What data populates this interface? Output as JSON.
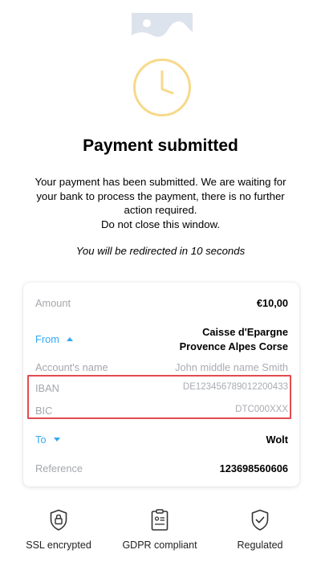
{
  "header": {
    "title": "Payment submitted",
    "description": [
      "Your payment has been submitted. We are waiting for",
      "your bank to process the payment, there is no further",
      "action required.",
      "Do not close this window."
    ],
    "redirect_text": "You will be redirected in 10 seconds"
  },
  "details": {
    "amount": {
      "label": "Amount",
      "value": "€10,00"
    },
    "from": {
      "label": "From",
      "bank_line1": "Caisse d'Epargne",
      "bank_line2": "Provence Alpes Corse"
    },
    "account_name": {
      "label": "Account's name",
      "value": "John middle name Smith"
    },
    "iban": {
      "label": "IBAN",
      "value": "DE123456789012200433"
    },
    "bic": {
      "label": "BIC",
      "value": "DTC000XXX"
    },
    "to": {
      "label": "To",
      "value": "Wolt"
    },
    "reference": {
      "label": "Reference",
      "value": "123698560606"
    }
  },
  "footer": {
    "ssl": "SSL encrypted",
    "gdpr": "GDPR compliant",
    "regulated": "Regulated"
  },
  "colors": {
    "accent_blue": "#31a9f4",
    "clock_yellow": "#f6d98a",
    "highlight_red": "#e24b50",
    "muted_text": "#a4a7ad"
  },
  "icons": [
    "image-placeholder-icon",
    "clock-icon",
    "caret-up-icon",
    "caret-down-icon",
    "lock-shield-icon",
    "document-icon",
    "check-shield-icon"
  ]
}
